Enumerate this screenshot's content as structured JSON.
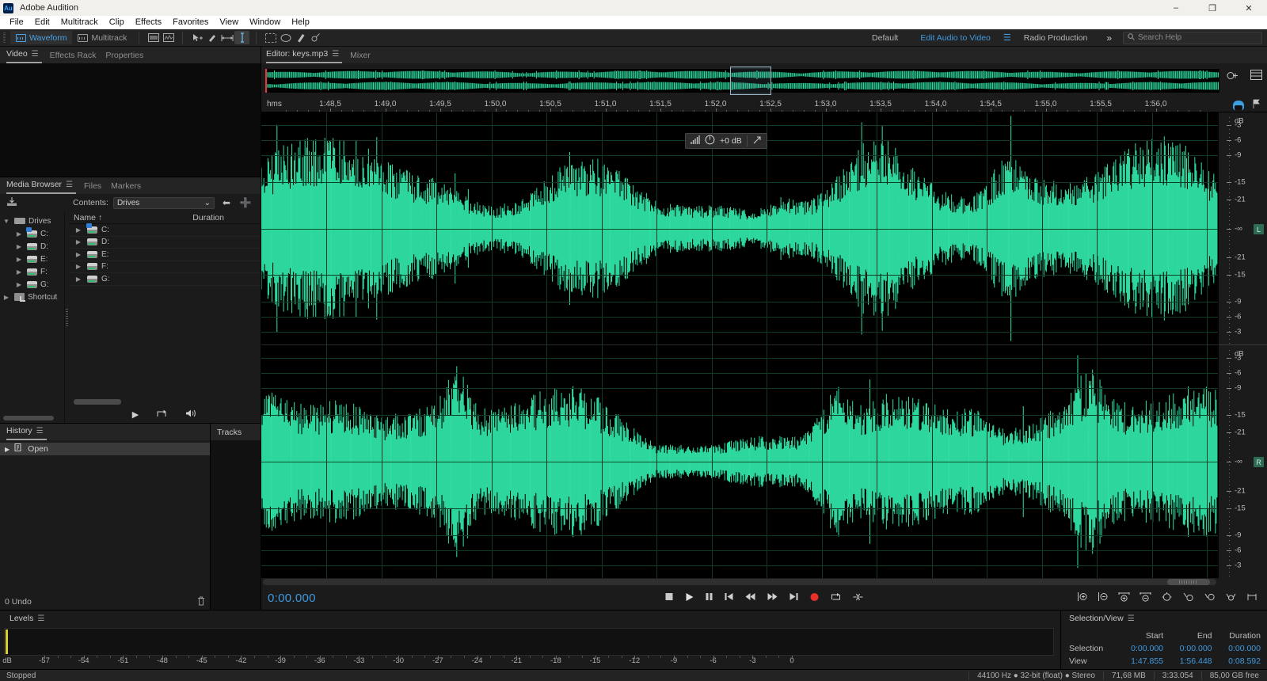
{
  "window": {
    "title": "Adobe Audition",
    "logo": "Au",
    "minimize": "–",
    "maximize": "❐",
    "close": "✕"
  },
  "menu": [
    "File",
    "Edit",
    "Multitrack",
    "Clip",
    "Effects",
    "Favorites",
    "View",
    "Window",
    "Help"
  ],
  "toolbar": {
    "waveform": "Waveform",
    "multitrack": "Multitrack",
    "tools": [
      "move-tool",
      "slip-tool",
      "time-selection-tool",
      "razor-tool",
      "marquee-selection-tool",
      "lasso-selection-tool",
      "paintbrush-selection-tool",
      "spot-healing-brush-tool"
    ],
    "workspaces": [
      "Default",
      "Edit Audio to Video",
      "Radio Production"
    ],
    "active_workspace": "Edit Audio to Video",
    "more": "»",
    "search_placeholder": "Search Help"
  },
  "left_panels": {
    "top_tabs": [
      {
        "label": "Video",
        "active": true
      },
      {
        "label": "Effects Rack",
        "active": false
      },
      {
        "label": "Properties",
        "active": false
      }
    ],
    "media_browser": {
      "tabs": [
        {
          "label": "Media Browser",
          "active": true
        },
        {
          "label": "Files",
          "active": false
        },
        {
          "label": "Markers",
          "active": false
        }
      ],
      "contents_label": "Contents:",
      "contents_value": "Drives",
      "tree": [
        {
          "label": "Drives",
          "icon": "rack-icon",
          "depth": 0,
          "expanded": true
        },
        {
          "label": "C:",
          "icon": "system-drive-icon",
          "depth": 1
        },
        {
          "label": "D:",
          "icon": "drive-icon",
          "depth": 1
        },
        {
          "label": "E:",
          "icon": "drive-icon",
          "depth": 1
        },
        {
          "label": "F:",
          "icon": "drive-icon",
          "depth": 1
        },
        {
          "label": "G:",
          "icon": "drive-icon",
          "depth": 1
        },
        {
          "label": "Shortcut",
          "icon": "shortcut-icon",
          "depth": 0
        }
      ],
      "columns": {
        "name": "Name",
        "sort_arrow": "↑",
        "duration": "Duration"
      },
      "rows": [
        {
          "name": "C:",
          "icon": "system-drive-icon",
          "duration": ""
        },
        {
          "name": "D:",
          "icon": "drive-icon",
          "duration": ""
        },
        {
          "name": "E:",
          "icon": "drive-icon",
          "duration": ""
        },
        {
          "name": "F:",
          "icon": "drive-icon",
          "duration": ""
        },
        {
          "name": "G:",
          "icon": "drive-icon",
          "duration": ""
        }
      ]
    },
    "history": {
      "title": "History",
      "items": [
        {
          "label": "Open",
          "selected": true
        }
      ],
      "undo_count": "0 Undo"
    },
    "tracks": {
      "title": "Tracks"
    }
  },
  "editor": {
    "tabs": [
      {
        "label": "Editor: keys.mp3",
        "active": true
      },
      {
        "label": "Mixer",
        "active": false
      }
    ],
    "ruler": {
      "unit": "hms",
      "labels": [
        "1:48,5",
        "1:49,0",
        "1:49,5",
        "1:50,0",
        "1:50,5",
        "1:51,0",
        "1:51,5",
        "1:52,0",
        "1:52,5",
        "1:53,0",
        "1:53,5",
        "1:54,0",
        "1:54,5",
        "1:55,0",
        "1:55,5",
        "1:56,0"
      ]
    },
    "gain": {
      "value": "+0 dB"
    },
    "db_scale": {
      "header": "dB",
      "labels": [
        "-3",
        "-6",
        "-9",
        "-15",
        "-21",
        "-∞",
        "-21",
        "-15",
        "-9",
        "-6",
        "-3"
      ],
      "channel_left": "L",
      "channel_right": "R"
    },
    "transport": {
      "time": "0:00.000",
      "buttons": [
        "stop",
        "play",
        "pause",
        "skip-to-start",
        "rewind",
        "fast-forward",
        "skip-to-end",
        "record",
        "loop",
        "skip-selection"
      ]
    },
    "zoom_buttons": [
      "zoom-in-amplitude",
      "zoom-out-amplitude",
      "zoom-in-time",
      "zoom-out-time",
      "zoom-out-full",
      "zoom-to-selection-in",
      "zoom-to-selection-out",
      "zoom-to-selection",
      "zoom-to-fit"
    ]
  },
  "levels": {
    "title": "Levels",
    "scale_unit": "dB",
    "ticks": [
      "-57",
      "-54",
      "-51",
      "-48",
      "-45",
      "-42",
      "-39",
      "-36",
      "-33",
      "-30",
      "-27",
      "-24",
      "-21",
      "-18",
      "-15",
      "-12",
      "-9",
      "-6",
      "-3",
      "0"
    ]
  },
  "selection_view": {
    "title": "Selection/View",
    "columns": [
      "Start",
      "End",
      "Duration"
    ],
    "rows": [
      {
        "label": "Selection",
        "start": "0:00.000",
        "end": "0:00.000",
        "duration": "0:00.000"
      },
      {
        "label": "View",
        "start": "1:47.855",
        "end": "1:56.448",
        "duration": "0:08.592"
      }
    ]
  },
  "status_bar": {
    "state": "Stopped",
    "format": "44100 Hz ● 32-bit (float) ● Stereo",
    "size": "71,68 MB",
    "duration": "3:33.054",
    "free": "85,00 GB free"
  },
  "colors": {
    "accent_blue": "#3f9ae0",
    "waveform": "#2fe0a3",
    "record_red": "#e03b3b",
    "panel_bg": "#1b1b1b"
  }
}
